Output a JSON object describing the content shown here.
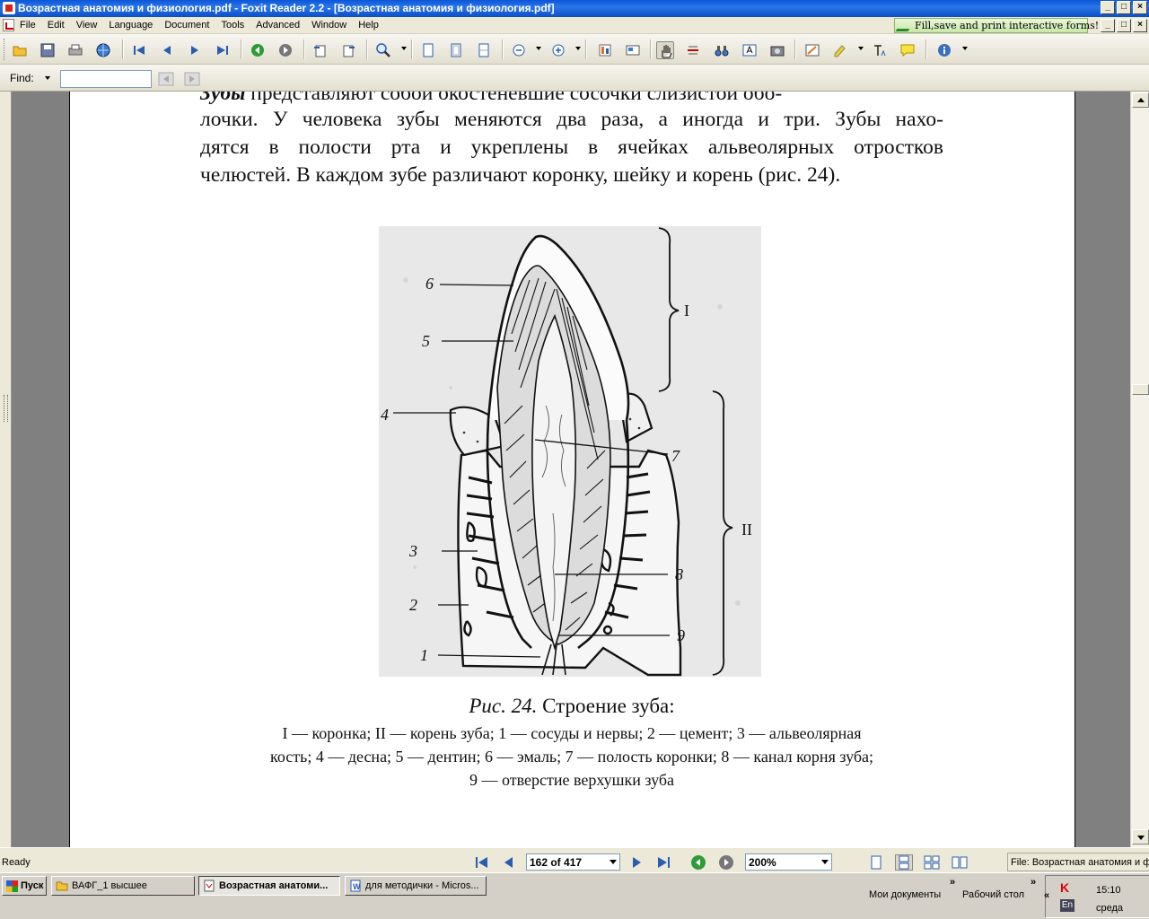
{
  "window": {
    "title": "Возрастная анатомия и физиология.pdf - Foxit Reader 2.2 - [Возрастная анатомия и физиология.pdf]",
    "min_glyph": "_",
    "max_glyph": "□",
    "close_glyph": "×"
  },
  "menu": {
    "items": [
      "File",
      "Edit",
      "View",
      "Language",
      "Document",
      "Tools",
      "Advanced",
      "Window",
      "Help"
    ],
    "fill_banner": "Fill,save and print interactive forms!"
  },
  "find": {
    "label": "Find:",
    "value": ""
  },
  "document": {
    "cut_line_bold": "Зубы",
    "cut_line": " представляют собой окостеневшие сосочки слизистой обо-",
    "body_lines": [
      "лочки. У человека зубы меняются два раза, а иногда и три. Зубы нахо-",
      "дятся в полости рта и укреплены в ячейках альвеолярных отростков",
      "челюстей. В каждом зубе различают коронку, шейку и корень (рис. 24)."
    ],
    "figure_labels": {
      "l6": "6",
      "l5": "5",
      "l4": "4",
      "l3": "3",
      "l2": "2",
      "l1": "1",
      "l7": "7",
      "l8": "8",
      "l9": "9",
      "rI": "I",
      "rII": "II"
    },
    "caption_number": "Рис. 24.",
    "caption_title": "Строение зуба:",
    "caption_lines": [
      "I — коронка; II  — корень зуба;  1 — сосуды и нервы; 2 — цемент; 3 — альвеолярная",
      "кость; 4 — десна; 5 — дентин; 6 — эмаль; 7 — полость коронки; 8 — канал корня зуба;",
      "9 — отверстие верхушки зуба"
    ]
  },
  "status": {
    "ready": "Ready",
    "page": "162 of 417",
    "zoom": "200%",
    "file": "File: Возрастная анатомия и физиология.pdf"
  },
  "taskbar": {
    "start": "Пуск",
    "tasks": [
      "ВАФГ_1 высшее",
      "Возрастная анатоми...",
      "для методички - Micros..."
    ],
    "quick1": "Мои документы",
    "quick2": "Рабочий стол",
    "chevron": "»",
    "tray_chevron": "«",
    "lang": "En",
    "time": "15:10",
    "day": "среда"
  },
  "colors": {
    "titlebar": "#0a56d8",
    "page_bg": "#ffffff",
    "workspace": "#808080",
    "figure_bg": "#e6e6e6"
  }
}
